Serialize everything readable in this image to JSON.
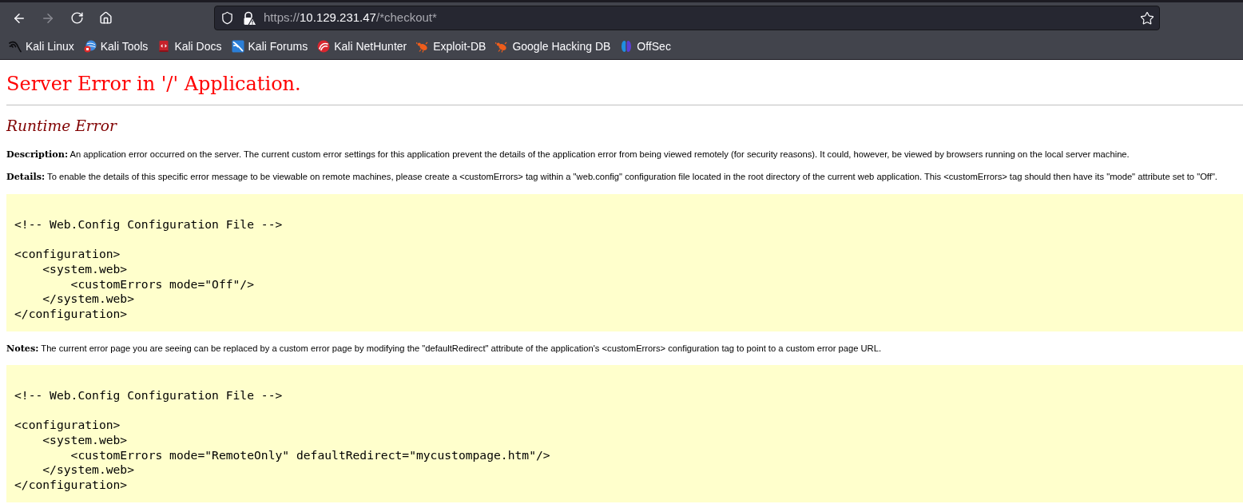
{
  "browser": {
    "back_button": {
      "disabled": false
    },
    "forward_button": {
      "disabled": true
    },
    "url": {
      "scheme": "https://",
      "host": "10.129.231.47",
      "path": "/*checkout*"
    }
  },
  "bookmarks": [
    {
      "label": "Kali Linux"
    },
    {
      "label": "Kali Tools"
    },
    {
      "label": "Kali Docs"
    },
    {
      "label": "Kali Forums"
    },
    {
      "label": "Kali NetHunter"
    },
    {
      "label": "Exploit-DB"
    },
    {
      "label": "Google Hacking DB"
    },
    {
      "label": "OffSec"
    }
  ],
  "page": {
    "title": "Server Error in '/' Application.",
    "subtitle": "Runtime Error",
    "sections": [
      {
        "kind": "paragraph",
        "text": "**Description:** An application error occurred on the server. The current custom error settings for this application prevent the details of the application error from being viewed remotely (for security reasons). It could, however, be viewed by browsers running on the local server machine."
      },
      {
        "kind": "paragraph",
        "text": "**Details:** To enable the details of this specific error message to be viewable on remote machines, please create a <customErrors> tag within a \"web.config\" configuration file located in the root directory of the current web application. This <customErrors> tag should then have its \"mode\" attribute set to \"Off\"."
      },
      {
        "kind": "code",
        "text": "<!-- Web.Config Configuration File -->\n\n<configuration>\n    <system.web>\n        <customErrors mode=\"Off\"/>\n    </system.web>\n</configuration>"
      },
      {
        "kind": "paragraph",
        "text": "**Notes:** The current error page you are seeing can be replaced by a custom error page by modifying the \"defaultRedirect\" attribute of the application's <customErrors> configuration tag to point to a custom error page URL."
      },
      {
        "kind": "code",
        "text": "<!-- Web.Config Configuration File -->\n\n<configuration>\n    <system.web>\n        <customErrors mode=\"RemoteOnly\" defaultRedirect=\"mycustompage.htm\"/>\n    </system.web>\n</configuration>"
      }
    ]
  }
}
